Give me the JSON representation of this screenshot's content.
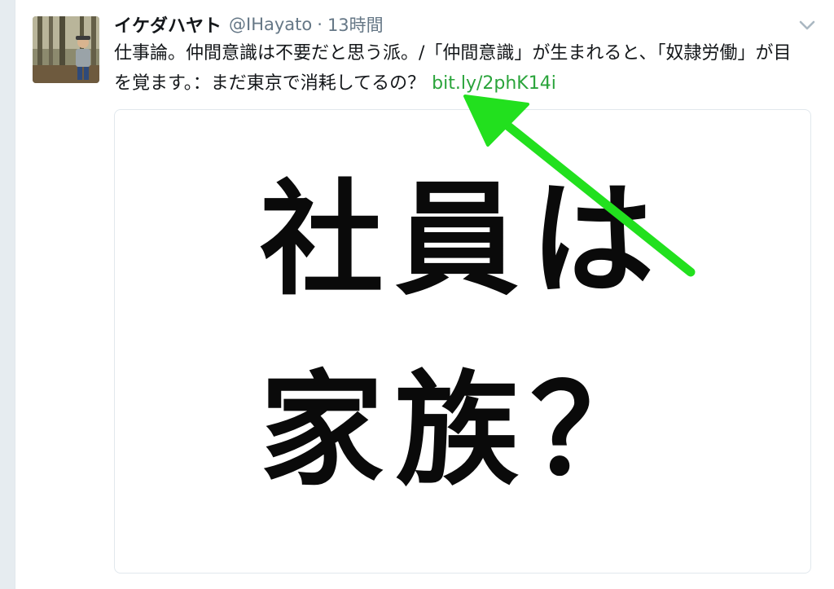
{
  "tweet": {
    "author_name": "イケダハヤト",
    "handle": "@IHayato",
    "separator": "·",
    "time": "13時間",
    "text": "仕事論。仲間意識は不要だと思う派。/「仲間意識」が生まれると、「奴隷労働」が目を覚ます。：まだ東京で消耗してるの？",
    "link_text": "bit.ly/2phK14i",
    "caret_icon": "chevron-down-icon"
  },
  "card": {
    "line1": "社員は",
    "line2": "家族？"
  },
  "annotation": {
    "arrow_color": "#22e01e",
    "link_color": "#2aa43b"
  }
}
